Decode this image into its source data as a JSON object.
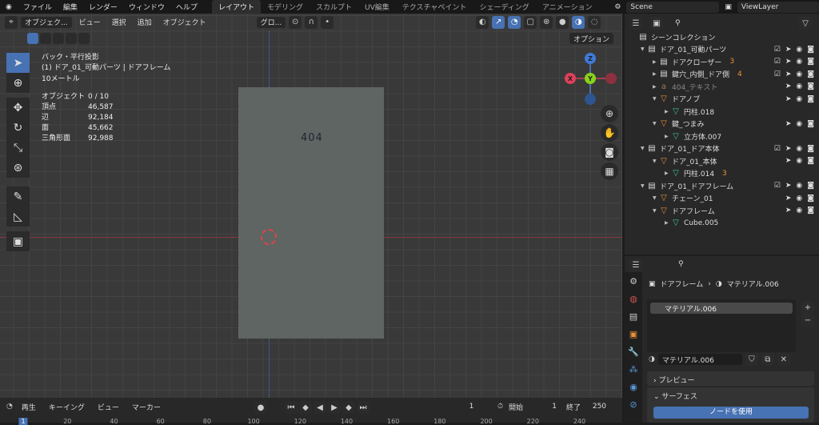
{
  "menu": {
    "items": [
      "ファイル",
      "編集",
      "レンダー",
      "ウィンドウ",
      "ヘルプ"
    ]
  },
  "workspaces": [
    "レイアウト",
    "モデリング",
    "スカルプト",
    "UV編集",
    "テクスチャペイント",
    "シェーディング",
    "アニメーション"
  ],
  "scene": "Scene",
  "view_layer": "ViewLayer",
  "viewport_header": {
    "mode": "オブジェク...",
    "view": "ビュー",
    "select": "選択",
    "add": "追加",
    "object": "オブジェクト",
    "orientation": "グロ...",
    "options": "オプション"
  },
  "overlay_info": {
    "view_name": "バック・平行投影",
    "context": "(1) ドア_01_可動パーツ | ドアフレーム",
    "scale": "10メートル",
    "stats": [
      {
        "label": "オブジェクト",
        "value": "0 / 10"
      },
      {
        "label": "頂点",
        "value": "46,587"
      },
      {
        "label": "辺",
        "value": "92,184"
      },
      {
        "label": "面",
        "value": "45,662"
      },
      {
        "label": "三角形面",
        "value": "92,988"
      }
    ]
  },
  "scene_text": "404",
  "gizmo": {
    "x": "X",
    "y": "Y",
    "z": "Z"
  },
  "outliner": {
    "root": "シーンコレクション",
    "rows": [
      {
        "label": "ドア_01_可動パーツ",
        "indent": 0,
        "type": "collection",
        "badge": ""
      },
      {
        "label": "ドアクローザー",
        "indent": 1,
        "type": "collection",
        "badge": "3"
      },
      {
        "label": "鍵穴_内側_ドア側",
        "indent": 1,
        "type": "collection",
        "badge": "4"
      },
      {
        "label": "404_テキスト",
        "indent": 1,
        "type": "text",
        "badge": ""
      },
      {
        "label": "ドアノブ",
        "indent": 1,
        "type": "object",
        "badge": ""
      },
      {
        "label": "円柱.018",
        "indent": 2,
        "type": "mesh",
        "badge": ""
      },
      {
        "label": "鍵_つまみ",
        "indent": 1,
        "type": "object",
        "badge": ""
      },
      {
        "label": "立方体.007",
        "indent": 2,
        "type": "mesh",
        "badge": ""
      },
      {
        "label": "ドア_01_ドア本体",
        "indent": 0,
        "type": "collection",
        "badge": ""
      },
      {
        "label": "ドア_01_本体",
        "indent": 1,
        "type": "object",
        "badge": ""
      },
      {
        "label": "円柱.014",
        "indent": 2,
        "type": "mesh",
        "badge": "3"
      },
      {
        "label": "ドア_01_ドアフレーム",
        "indent": 0,
        "type": "collection",
        "badge": ""
      },
      {
        "label": "チェーン_01",
        "indent": 1,
        "type": "object",
        "badge": ""
      },
      {
        "label": "ドアフレーム",
        "indent": 1,
        "type": "object",
        "badge": ""
      },
      {
        "label": "Cube.005",
        "indent": 2,
        "type": "mesh",
        "badge": ""
      }
    ]
  },
  "properties": {
    "breadcrumb_object": "ドアフレーム",
    "breadcrumb_material": "マテリアル.006",
    "slot": "マテリアル.006",
    "material_name": "マテリアル.006",
    "preview": "プレビュー",
    "surface": "サーフェス",
    "use_nodes": "ノードを使用"
  },
  "timeline": {
    "play": "再生",
    "keying": "キーイング",
    "view": "ビュー",
    "marker": "マーカー",
    "current_frame": "1",
    "start_label": "開始",
    "start": "1",
    "end_label": "終了",
    "end": "250",
    "ticks": [
      "1",
      "20",
      "40",
      "60",
      "80",
      "100",
      "120",
      "140",
      "160",
      "180",
      "200",
      "220",
      "240"
    ]
  }
}
